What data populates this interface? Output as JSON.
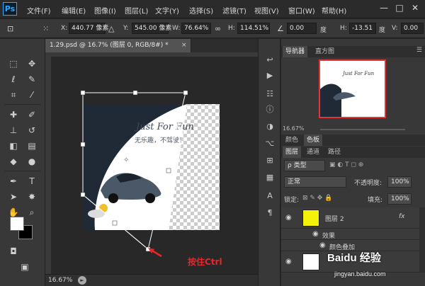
{
  "app": {
    "logo": "Ps"
  },
  "menu": [
    "文件(F)",
    "编辑(E)",
    "图像(I)",
    "图层(L)",
    "文字(Y)",
    "选择(S)",
    "滤镜(T)",
    "视图(V)",
    "窗口(W)",
    "帮助(H)"
  ],
  "window_buttons": [
    "—",
    "□",
    "✕"
  ],
  "options": {
    "x_label": "X:",
    "x_value": "440.77 像素",
    "y_label": "Y:",
    "y_value": "545.00 像素",
    "w_label": "W:",
    "w_value": "76.64%",
    "h_label": "H:",
    "h_value": "114.51%",
    "angle_value": "0.00",
    "angle_unit": "度",
    "hskew_label": "H:",
    "hskew_value": "-13.51",
    "hskew_unit": "度",
    "v_label": "V:",
    "v_value": "0.00"
  },
  "document": {
    "tab_label": "1.29.psd @ 16.7% (图层 0, RGB/8#) *",
    "close": "×",
    "zoom_status": "16.67%",
    "image_title": "Just For Fun",
    "image_subtitle": "无乐趣，不驾驶！"
  },
  "panels": {
    "nav_tabs": [
      "导航器",
      "直方图"
    ],
    "nav_zoom": "16.67%",
    "color_tabs": [
      "颜色",
      "色板"
    ],
    "layer_tabs": [
      "图层",
      "通道",
      "路径"
    ],
    "filter_label": "ρ 类型",
    "blend_mode": "正常",
    "opacity_label": "不透明度:",
    "opacity_value": "100%",
    "lock_label": "锁定:",
    "fill_label": "填充:",
    "fill_value": "100%",
    "layers": [
      {
        "name": "图层 2",
        "fx": "fx"
      },
      {
        "name": "效果",
        "sub": true
      },
      {
        "name": "颜色叠加",
        "sub": true
      }
    ]
  },
  "annotation": "按住Ctrl",
  "watermark": {
    "brand": "Baidu 经验",
    "url": "jingyan.baidu.com"
  }
}
